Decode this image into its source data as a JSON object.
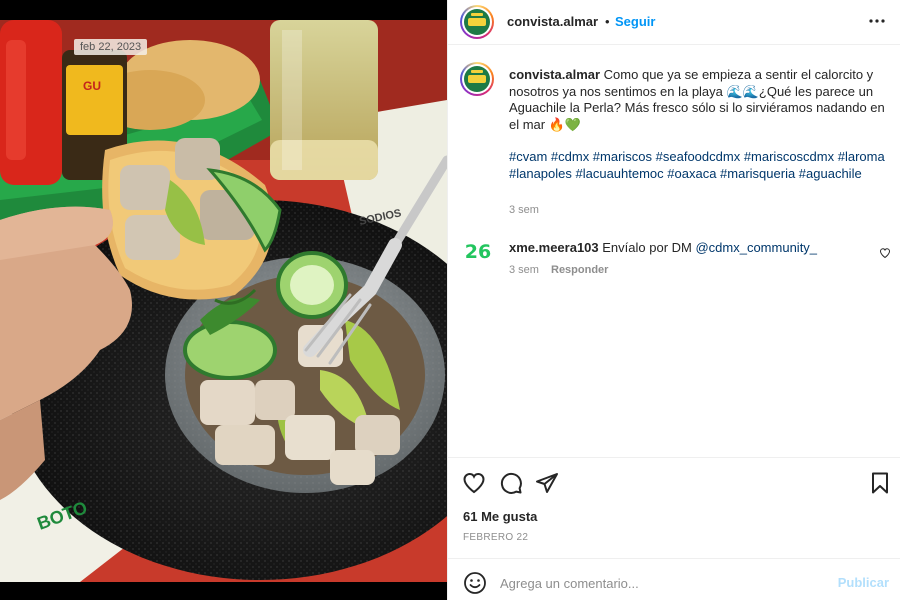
{
  "photo": {
    "date_tag": "feb 22, 2023",
    "sauce_label": "GU",
    "paper_text": "BOTO",
    "paper_side_text": "SODIOS"
  },
  "header": {
    "username": "convista.almar",
    "dot": "•",
    "follow_label": "Seguir",
    "more_icon": "more-horizontal-icon"
  },
  "caption": {
    "username": "convista.almar",
    "text_part1": "Como que ya se empieza a sentir el calorcito y nosotros ya nos sentimos en la playa ",
    "emoji_waves": "🌊🌊",
    "text_part2": "¿Qué les parece un Aguachile la Perla? Más fresco sólo si lo sirviéramos nadando en el mar ",
    "emoji_end": "🔥💚",
    "hashtags": "#cvam #cdmx #mariscos #seafoodcdmx #mariscoscdmx #laroma #lanapoles #lacuauhtemoc #oaxaca #marisqueria #aguachile",
    "time": "3 sem"
  },
  "comment": {
    "avatar_text": "26",
    "username": "xme.meera103",
    "text": "Envíalo por DM ",
    "mention": "@cdmx_community_",
    "time": "3 sem",
    "reply_label": "Responder"
  },
  "actions": {
    "like_icon": "heart-icon",
    "comment_icon": "comment-icon",
    "share_icon": "share-icon",
    "save_icon": "bookmark-icon",
    "likes": "61 Me gusta",
    "date": "FEBRERO 22"
  },
  "add_comment": {
    "placeholder": "Agrega un comentario...",
    "publish_label": "Publicar"
  },
  "colors": {
    "link_blue": "#0095f6",
    "hashtag_blue": "#00376b",
    "muted": "#8e8e8e",
    "publish_disabled": "#b2dffc",
    "avatar_green": "#1e7a45"
  }
}
